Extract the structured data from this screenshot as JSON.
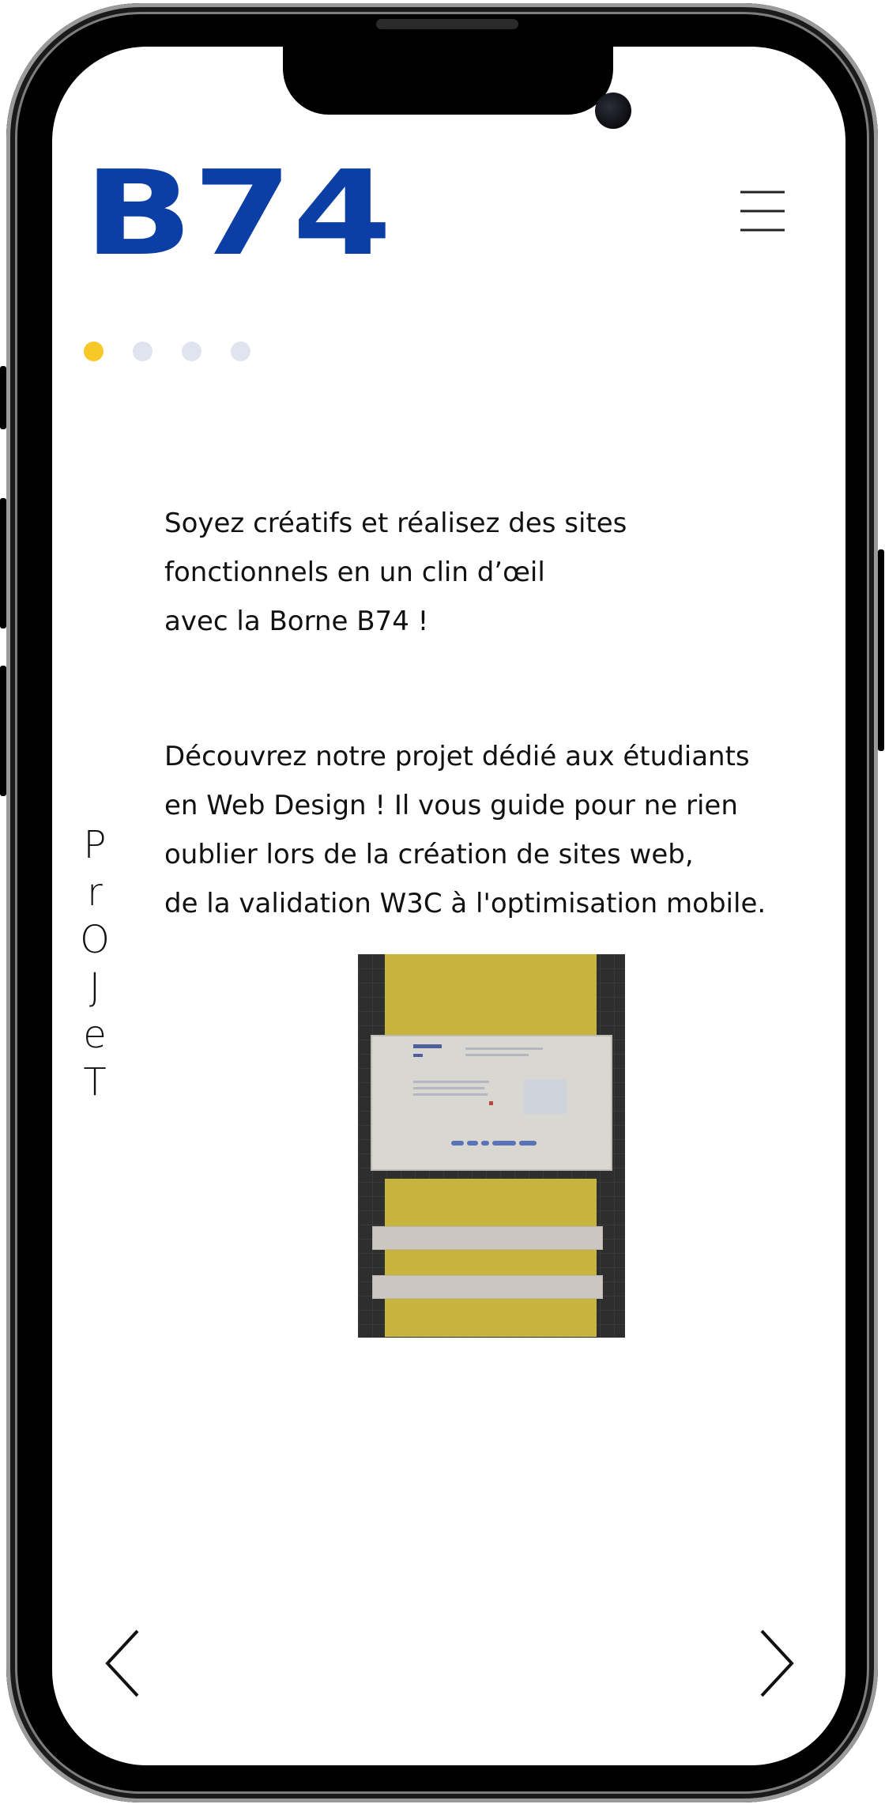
{
  "app": {
    "logo_text": "B74",
    "brand_color": "#0b3fa6",
    "accent_dot_color": "#f6c928"
  },
  "carousel": {
    "dots": [
      {
        "state": "active"
      },
      {
        "state": "inactive"
      },
      {
        "state": "inactive"
      },
      {
        "state": "inactive"
      }
    ],
    "side_label": [
      "P",
      "r",
      "O",
      "J",
      "e",
      "T"
    ]
  },
  "content": {
    "paragraph_1": "Soyez créatifs et réalisez des sites\nfonctionnels en un clin d’œil\navec la Borne B74 !",
    "paragraph_2": "Découvrez notre projet dédié aux étudiants\nen Web Design ! Il vous guide pour ne rien\noublier lors de la création de sites web,\nde la validation W3C à l'optimisation mobile."
  },
  "icons": {
    "menu": "hamburger-icon",
    "prev": "chevron-left-icon",
    "next": "chevron-right-icon"
  }
}
